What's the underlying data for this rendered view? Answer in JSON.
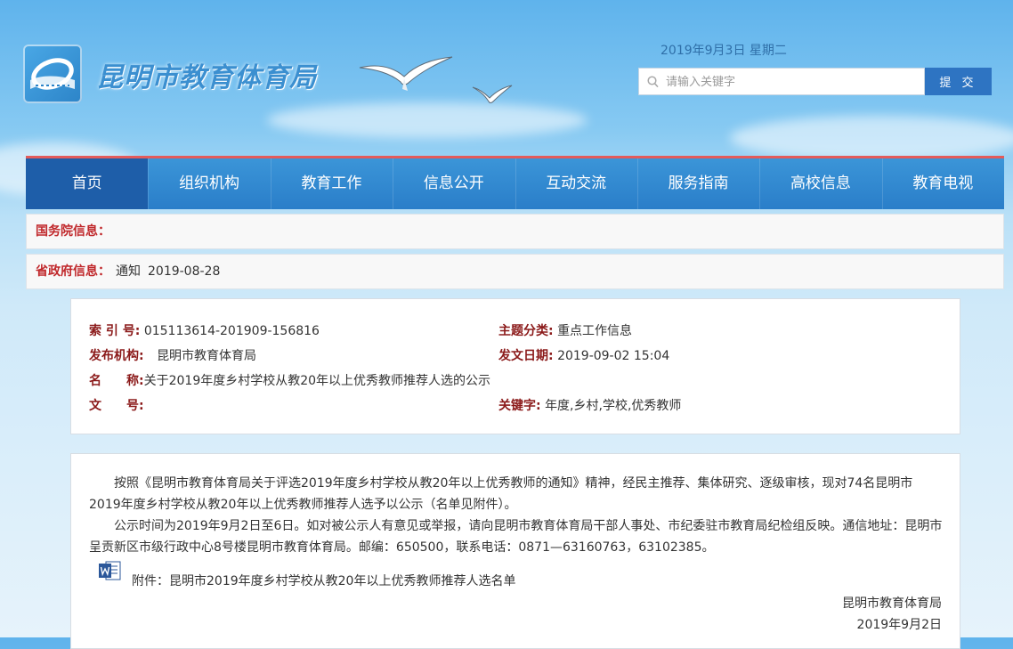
{
  "header": {
    "site_title": "昆明市教育体育局",
    "date": "2019年9月3日  星期二",
    "search_placeholder": "请输入关键字",
    "submit_label": "提 交"
  },
  "nav": {
    "items": [
      {
        "label": "首页",
        "active": true
      },
      {
        "label": "组织机构"
      },
      {
        "label": "教育工作"
      },
      {
        "label": "信息公开"
      },
      {
        "label": "互动交流"
      },
      {
        "label": "服务指南"
      },
      {
        "label": "高校信息"
      },
      {
        "label": "教育电视"
      }
    ]
  },
  "state_council": {
    "label": "国务院信息："
  },
  "provincial": {
    "label": "省政府信息：",
    "text": "通知",
    "date": "2019-08-28"
  },
  "meta": {
    "index_label": "索 引 号:",
    "index_value": "015113614-201909-156816",
    "theme_label": "主题分类:",
    "theme_value": "重点工作信息",
    "org_label": "发布机构:",
    "org_value": "昆明市教育体育局",
    "issue_date_label": "发文日期:",
    "issue_date_value": "2019-09-02 15:04",
    "name_label": "名　　称:",
    "name_value": "关于2019年度乡村学校从教20年以上优秀教师推荐人选的公示",
    "doc_no_label": "文　　号:",
    "doc_no_value": "",
    "keywords_label": "关键字:",
    "keywords_value": "年度,乡村,学校,优秀教师"
  },
  "content": {
    "para1": "按照《昆明市教育体育局关于评选2019年度乡村学校从教20年以上优秀教师的通知》精神，经民主推荐、集体研究、逐级审核，现对74名昆明市2019年度乡村学校从教20年以上优秀教师推荐人选予以公示（名单见附件）。",
    "para2": "公示时间为2019年9月2日至6日。如对被公示人有意见或举报，请向昆明市教育体育局干部人事处、市纪委驻市教育局纪检组反映。通信地址：昆明市呈贡新区市级行政中心8号楼昆明市教育体育局。邮编：650500，联系电话：0871—63160763，63102385。",
    "attachment": "附件：昆明市2019年度乡村学校从教20年以上优秀教师推荐人选名单",
    "sign_org": "昆明市教育体育局",
    "sign_date": "2019年9月2日"
  },
  "colors": {
    "nav_bg": "#2a7ec9",
    "nav_active": "#1e5ea9",
    "label_red": "#c0282b",
    "submit_bg": "#2e74c2"
  }
}
